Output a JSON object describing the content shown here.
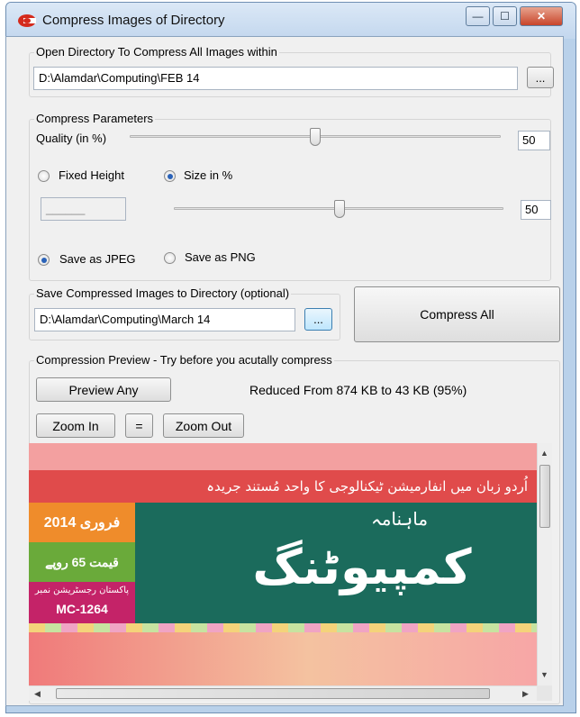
{
  "window": {
    "title": "Compress Images of Directory",
    "buttons": {
      "minimize": "—",
      "maximize": "☐",
      "close": "✕"
    }
  },
  "open_dir": {
    "label": "Open Directory To Compress All Images within",
    "path": "D:\\Alamdar\\Computing\\FEB 14",
    "browse": "..."
  },
  "params": {
    "label": "Compress Parameters",
    "quality_label": "Quality (in %)",
    "quality_value": "50",
    "quality_fraction": 0.5,
    "fixed_height_label": "Fixed Height",
    "size_pct_label": "Size in %",
    "size_mode": "size_pct",
    "height_field": "______",
    "size_value": "50",
    "size_fraction": 0.5,
    "save_jpeg": "Save as JPEG",
    "save_png": "Save as PNG",
    "format": "jpeg"
  },
  "save_dir": {
    "label": "Save Compressed Images to Directory (optional)",
    "path": "D:\\Alamdar\\Computing\\March 14",
    "browse": "...",
    "compress_all": "Compress All"
  },
  "preview": {
    "label": "Compression Preview - Try before you acutally compress",
    "preview_btn": "Preview Any",
    "result": "Reduced From 874 KB to 43 KB (95%)",
    "zoom_in": "Zoom In",
    "equal": "=",
    "zoom_out": "Zoom Out",
    "image": {
      "tagline": "اُردو زبان میں انفارمیشن ٹیکنالوجی کا واحد مُستند جریدہ",
      "monthly": "ماہنامہ",
      "masthead": "کمپیوٹنگ",
      "date_box": "فروری 2014",
      "price_box": "قیمت 65 روپے",
      "reg_label": "پاکستان رجسٹریشن نمبر",
      "reg_no": "MC-1264"
    }
  },
  "colors": {
    "window_frame": "#b9d1ea",
    "dialog_bg": "#f0f0f0",
    "magazine_red": "#e04b4b",
    "magazine_green": "#1b6b5c",
    "magazine_orange": "#ef8c2b"
  },
  "icons": {
    "app": "app-logo-icon",
    "scroll_up": "chevron-up-icon",
    "scroll_down": "chevron-down-icon",
    "scroll_left": "chevron-left-icon",
    "scroll_right": "chevron-right-icon"
  }
}
